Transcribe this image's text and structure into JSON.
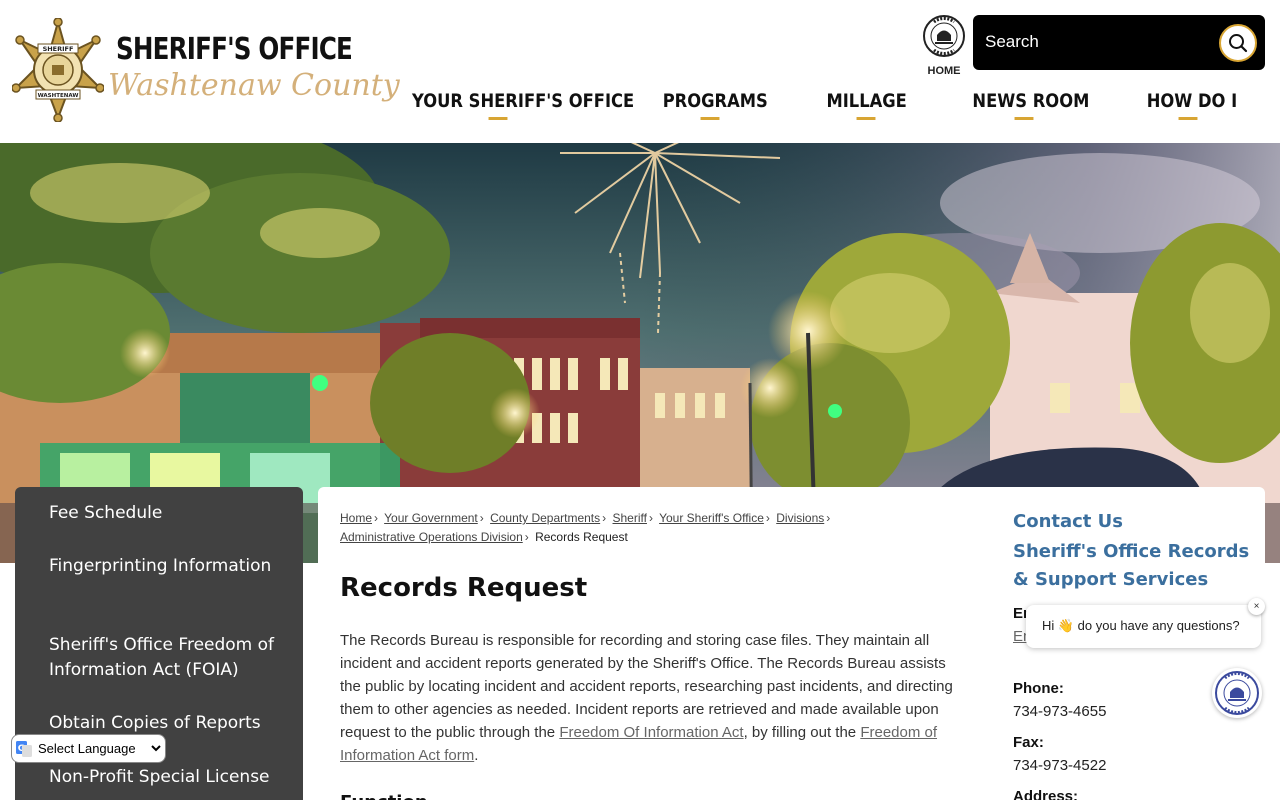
{
  "header": {
    "logo_title": "SHERIFF'S OFFICE",
    "logo_subtitle": "Washtenaw County",
    "badge_text_top": "SHERIFF",
    "badge_text_bottom": "WASHTENAW",
    "home_label": "HOME",
    "search_placeholder": "Search"
  },
  "nav": {
    "items": [
      {
        "label": "YOUR SHERIFF'S OFFICE"
      },
      {
        "label": "PROGRAMS"
      },
      {
        "label": "MILLAGE"
      },
      {
        "label": "NEWS ROOM"
      },
      {
        "label": "HOW DO I"
      }
    ]
  },
  "sidebar": {
    "items": [
      {
        "label": "Fee Schedule"
      },
      {
        "label": "Fingerprinting Information"
      },
      {
        "label": "Sheriff's Office Freedom of Information Act (FOIA)"
      },
      {
        "label": "Obtain Copies of Reports"
      },
      {
        "label": "Non-Profit Special License"
      }
    ]
  },
  "translate": {
    "selected": "Select Language"
  },
  "breadcrumb": {
    "items": [
      {
        "label": "Home"
      },
      {
        "label": "Your Government"
      },
      {
        "label": "County Departments"
      },
      {
        "label": "Sheriff"
      },
      {
        "label": "Your Sheriff's Office"
      },
      {
        "label": "Divisions"
      },
      {
        "label": "Administrative Operations Division"
      }
    ],
    "current": "Records Request",
    "separator": "›"
  },
  "main": {
    "title": "Records Request",
    "body_part1": "The Records Bureau is responsible for recording and storing case files. They maintain all incident and accident reports generated by the Sheriff's Office. The Records Bureau assists the public by locating incident and accident reports, researching past incidents, and directing them to other agencies as needed. Incident reports are retrieved and made available upon request to the public through the ",
    "link1": "Freedom Of Information Act",
    "body_part2": ", by filling out the ",
    "link2": "Freedom of Information Act form",
    "body_part3": ".",
    "next_heading": "Function"
  },
  "contact": {
    "title": "Contact Us",
    "org": "Sheriff's Office Records & Support Services",
    "email_label": "Em",
    "email_link": "Em",
    "phone_label": "Phone:",
    "phone": "734-973-4655",
    "fax_label": "Fax:",
    "fax": "734-973-4522",
    "address_label": "Address:"
  },
  "chat": {
    "message": "Hi 👋 do you have any questions?",
    "close": "×"
  },
  "colors": {
    "accent_gold": "#d8a533",
    "sidebar_bg": "#414141",
    "contact_blue": "#3b6f9e",
    "logo_script": "#d4b07a"
  }
}
